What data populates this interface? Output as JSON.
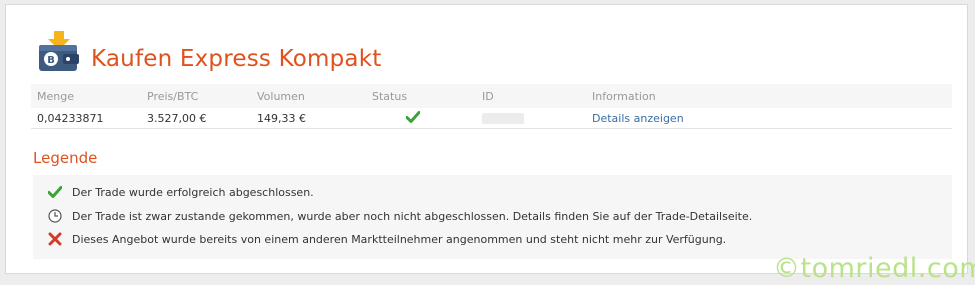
{
  "header": {
    "title": "Kaufen Express Kompakt",
    "icon": "wallet-bitcoin-icon"
  },
  "table": {
    "columns": [
      "Menge",
      "Preis/BTC",
      "Volumen",
      "Status",
      "ID",
      "Information"
    ],
    "rows": [
      {
        "menge": "0,04233871",
        "preis": "3.527,00 €",
        "volumen": "149,33 €",
        "status": "check-icon",
        "id": "",
        "information": "Details anzeigen"
      }
    ]
  },
  "legend": {
    "title": "Legende",
    "items": [
      {
        "icon": "check-icon",
        "text": "Der Trade wurde erfolgreich abgeschlossen."
      },
      {
        "icon": "clock-icon",
        "text": "Der Trade ist zwar zustande gekommen, wurde aber noch nicht abgeschlossen. Details finden Sie auf der Trade-Detailseite."
      },
      {
        "icon": "cross-icon",
        "text": "Dieses Angebot wurde bereits von einem anderen Marktteilnehmer angenommen und steht nicht mehr zur Verfügung."
      }
    ]
  },
  "watermark": "©tomriedl.com",
  "colors": {
    "accent": "#e0521d",
    "link": "#3a6ea5",
    "check": "#3aa335",
    "cross": "#d23a2a"
  }
}
